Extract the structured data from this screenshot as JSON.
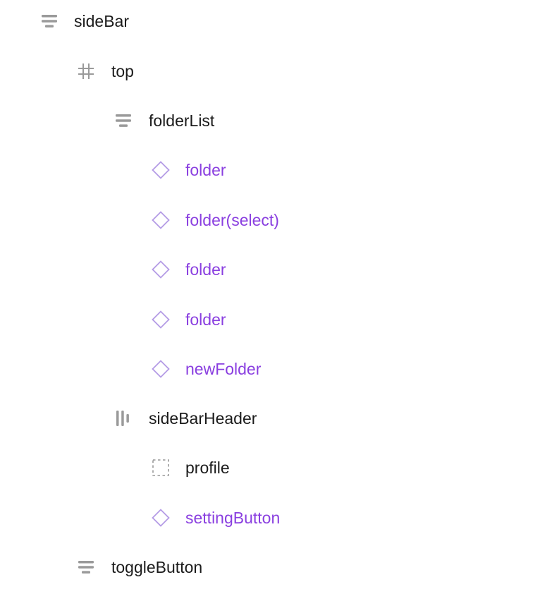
{
  "layers": [
    {
      "name": "sideBar",
      "icon": "auto-layout-vertical-icon",
      "kind": "frame"
    },
    {
      "name": "top",
      "icon": "frame-hash-icon",
      "kind": "frame"
    },
    {
      "name": "folderList",
      "icon": "auto-layout-vertical-icon",
      "kind": "frame"
    },
    {
      "name": "folder",
      "icon": "component-instance-icon",
      "kind": "instance"
    },
    {
      "name": "folder(select)",
      "icon": "component-instance-icon",
      "kind": "instance"
    },
    {
      "name": "folder",
      "icon": "component-instance-icon",
      "kind": "instance"
    },
    {
      "name": "folder",
      "icon": "component-instance-icon",
      "kind": "instance"
    },
    {
      "name": "newFolder",
      "icon": "component-instance-icon",
      "kind": "instance"
    },
    {
      "name": "sideBarHeader",
      "icon": "auto-layout-horizontal-icon",
      "kind": "frame"
    },
    {
      "name": "profile",
      "icon": "dashed-frame-icon",
      "kind": "frame"
    },
    {
      "name": "settingButton",
      "icon": "component-instance-icon",
      "kind": "instance"
    },
    {
      "name": "toggleButton",
      "icon": "auto-layout-vertical-icon",
      "kind": "frame"
    }
  ],
  "colors": {
    "text": "#1b1b1b",
    "component_text": "#8a3fe0",
    "component_icon": "#b49be6",
    "frame_icon": "#9a9a9a"
  }
}
